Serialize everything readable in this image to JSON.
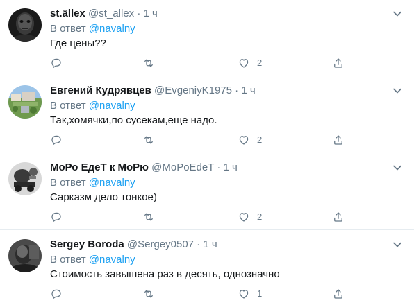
{
  "reply_prefix": "В ответ",
  "tweets": [
    {
      "name": "st.ällex",
      "handle": "@st_allex",
      "dot": "·",
      "time": "1 ч",
      "mention": "@navalny",
      "text": "Где цены??",
      "likes": "2"
    },
    {
      "name": "Евгений Кудрявцев",
      "handle": "@EvgeniyK1975",
      "dot": "·",
      "time": "1 ч",
      "mention": "@navalny",
      "text": "Так,хомячки,по сусекам,еще надо.",
      "likes": "2"
    },
    {
      "name": "МоРо ЕдеТ к МоРю",
      "handle": "@MoPoEdeT",
      "dot": "·",
      "time": "1 ч",
      "mention": "@navalny",
      "text": "Сарказм дело тонкое)",
      "likes": "2"
    },
    {
      "name": "Sergey Boroda",
      "handle": "@Sergey0507",
      "dot": "·",
      "time": "1 ч",
      "mention": "@navalny",
      "text": "Стоимость завышена раз в десять, однозначно",
      "likes": "1"
    }
  ],
  "icons": {
    "reply": "reply-icon",
    "retweet": "retweet-icon",
    "like": "heart-icon",
    "share": "share-icon",
    "menu": "chevron-down-icon"
  },
  "colors": {
    "name": "#14171a",
    "secondary": "#657786",
    "link": "#1da1f2",
    "divider": "#e6ecf0"
  }
}
